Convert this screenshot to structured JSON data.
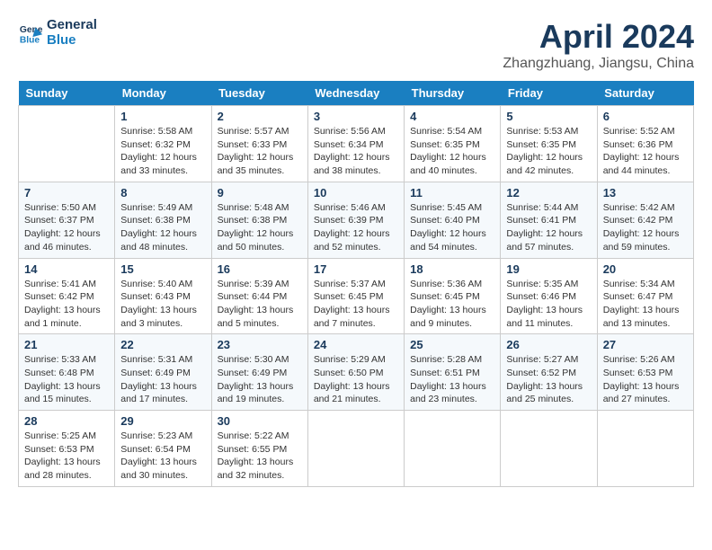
{
  "header": {
    "logo_line1": "General",
    "logo_line2": "Blue",
    "title": "April 2024",
    "subtitle": "Zhangzhuang, Jiangsu, China"
  },
  "weekdays": [
    "Sunday",
    "Monday",
    "Tuesday",
    "Wednesday",
    "Thursday",
    "Friday",
    "Saturday"
  ],
  "weeks": [
    [
      {
        "day": "",
        "content": ""
      },
      {
        "day": "1",
        "content": "Sunrise: 5:58 AM\nSunset: 6:32 PM\nDaylight: 12 hours\nand 33 minutes."
      },
      {
        "day": "2",
        "content": "Sunrise: 5:57 AM\nSunset: 6:33 PM\nDaylight: 12 hours\nand 35 minutes."
      },
      {
        "day": "3",
        "content": "Sunrise: 5:56 AM\nSunset: 6:34 PM\nDaylight: 12 hours\nand 38 minutes."
      },
      {
        "day": "4",
        "content": "Sunrise: 5:54 AM\nSunset: 6:35 PM\nDaylight: 12 hours\nand 40 minutes."
      },
      {
        "day": "5",
        "content": "Sunrise: 5:53 AM\nSunset: 6:35 PM\nDaylight: 12 hours\nand 42 minutes."
      },
      {
        "day": "6",
        "content": "Sunrise: 5:52 AM\nSunset: 6:36 PM\nDaylight: 12 hours\nand 44 minutes."
      }
    ],
    [
      {
        "day": "7",
        "content": "Sunrise: 5:50 AM\nSunset: 6:37 PM\nDaylight: 12 hours\nand 46 minutes."
      },
      {
        "day": "8",
        "content": "Sunrise: 5:49 AM\nSunset: 6:38 PM\nDaylight: 12 hours\nand 48 minutes."
      },
      {
        "day": "9",
        "content": "Sunrise: 5:48 AM\nSunset: 6:38 PM\nDaylight: 12 hours\nand 50 minutes."
      },
      {
        "day": "10",
        "content": "Sunrise: 5:46 AM\nSunset: 6:39 PM\nDaylight: 12 hours\nand 52 minutes."
      },
      {
        "day": "11",
        "content": "Sunrise: 5:45 AM\nSunset: 6:40 PM\nDaylight: 12 hours\nand 54 minutes."
      },
      {
        "day": "12",
        "content": "Sunrise: 5:44 AM\nSunset: 6:41 PM\nDaylight: 12 hours\nand 57 minutes."
      },
      {
        "day": "13",
        "content": "Sunrise: 5:42 AM\nSunset: 6:42 PM\nDaylight: 12 hours\nand 59 minutes."
      }
    ],
    [
      {
        "day": "14",
        "content": "Sunrise: 5:41 AM\nSunset: 6:42 PM\nDaylight: 13 hours\nand 1 minute."
      },
      {
        "day": "15",
        "content": "Sunrise: 5:40 AM\nSunset: 6:43 PM\nDaylight: 13 hours\nand 3 minutes."
      },
      {
        "day": "16",
        "content": "Sunrise: 5:39 AM\nSunset: 6:44 PM\nDaylight: 13 hours\nand 5 minutes."
      },
      {
        "day": "17",
        "content": "Sunrise: 5:37 AM\nSunset: 6:45 PM\nDaylight: 13 hours\nand 7 minutes."
      },
      {
        "day": "18",
        "content": "Sunrise: 5:36 AM\nSunset: 6:45 PM\nDaylight: 13 hours\nand 9 minutes."
      },
      {
        "day": "19",
        "content": "Sunrise: 5:35 AM\nSunset: 6:46 PM\nDaylight: 13 hours\nand 11 minutes."
      },
      {
        "day": "20",
        "content": "Sunrise: 5:34 AM\nSunset: 6:47 PM\nDaylight: 13 hours\nand 13 minutes."
      }
    ],
    [
      {
        "day": "21",
        "content": "Sunrise: 5:33 AM\nSunset: 6:48 PM\nDaylight: 13 hours\nand 15 minutes."
      },
      {
        "day": "22",
        "content": "Sunrise: 5:31 AM\nSunset: 6:49 PM\nDaylight: 13 hours\nand 17 minutes."
      },
      {
        "day": "23",
        "content": "Sunrise: 5:30 AM\nSunset: 6:49 PM\nDaylight: 13 hours\nand 19 minutes."
      },
      {
        "day": "24",
        "content": "Sunrise: 5:29 AM\nSunset: 6:50 PM\nDaylight: 13 hours\nand 21 minutes."
      },
      {
        "day": "25",
        "content": "Sunrise: 5:28 AM\nSunset: 6:51 PM\nDaylight: 13 hours\nand 23 minutes."
      },
      {
        "day": "26",
        "content": "Sunrise: 5:27 AM\nSunset: 6:52 PM\nDaylight: 13 hours\nand 25 minutes."
      },
      {
        "day": "27",
        "content": "Sunrise: 5:26 AM\nSunset: 6:53 PM\nDaylight: 13 hours\nand 27 minutes."
      }
    ],
    [
      {
        "day": "28",
        "content": "Sunrise: 5:25 AM\nSunset: 6:53 PM\nDaylight: 13 hours\nand 28 minutes."
      },
      {
        "day": "29",
        "content": "Sunrise: 5:23 AM\nSunset: 6:54 PM\nDaylight: 13 hours\nand 30 minutes."
      },
      {
        "day": "30",
        "content": "Sunrise: 5:22 AM\nSunset: 6:55 PM\nDaylight: 13 hours\nand 32 minutes."
      },
      {
        "day": "",
        "content": ""
      },
      {
        "day": "",
        "content": ""
      },
      {
        "day": "",
        "content": ""
      },
      {
        "day": "",
        "content": ""
      }
    ]
  ]
}
